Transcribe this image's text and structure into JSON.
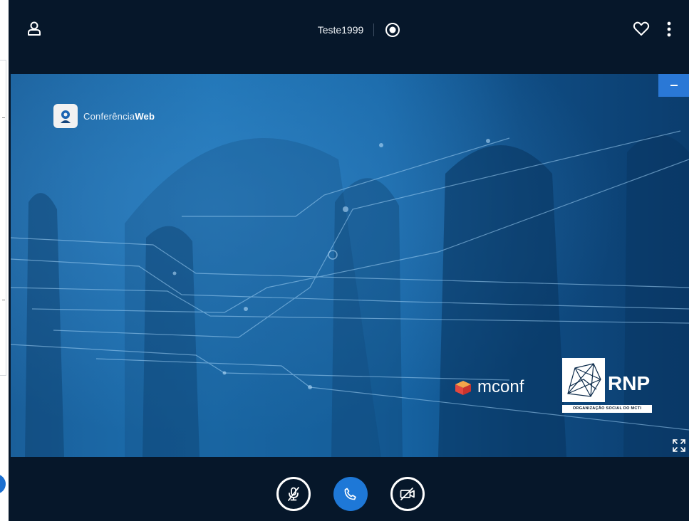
{
  "meeting": {
    "title": "Teste1999"
  },
  "icons": {
    "user": "user-icon",
    "record": "record-icon",
    "heart": "heart-icon",
    "more": "more-vertical-icon",
    "minimize": "minimize-icon",
    "fullscreen": "fullscreen-icon",
    "mic_muted": "mic-off-icon",
    "phone": "phone-icon",
    "camera_off": "video-off-icon"
  },
  "presentation": {
    "brand_prefix": "Conferência",
    "brand_suffix": "Web",
    "partner1": "mconf",
    "partner2": "RNP",
    "partner2_tagline": "ORGANIZAÇÃO SOCIAL DO MCTI"
  },
  "colors": {
    "bar_background": "#06172a",
    "accent": "#1e78d7",
    "stage_blue": "#1c71b2"
  }
}
